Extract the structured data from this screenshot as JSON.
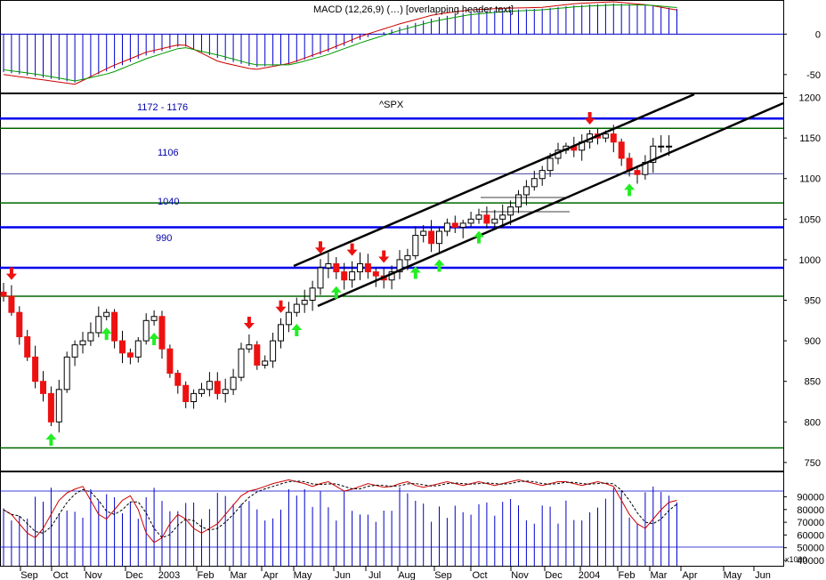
{
  "colors": {
    "up_candle": "#ffffff",
    "down_candle": "#ee1111",
    "candle_edge": "#000000",
    "support_blue": "#0000ee",
    "support_green": "#006600",
    "channel": "#000000",
    "arrow_up": "#22ee22",
    "arrow_down": "#ee1111",
    "macd_line_red": "#cc0000",
    "macd_line_green": "#009900",
    "histogram": "#0000cc",
    "stoch_k": "#cc0000",
    "stoch_d": "#000000",
    "volume": "#0000cc"
  },
  "chart_data": [
    {
      "panel": "macd",
      "type": "line",
      "title": "MACD (12,26,9) (…) [overlapping header text]",
      "y_ticks": [
        0,
        -50
      ],
      "ylim": [
        -70,
        40
      ],
      "x": [
        "Sep",
        "Oct",
        "Nov",
        "Dec",
        "2003",
        "Feb",
        "Mar",
        "Apr",
        "May",
        "Jun",
        "Jul",
        "Aug",
        "Sep",
        "Oct",
        "Nov",
        "Dec",
        "2004",
        "Feb",
        "Mar",
        "Apr"
      ],
      "series": [
        {
          "values": [
            -50,
            -56,
            -62,
            -40,
            -22,
            -12,
            -34,
            -44,
            -36,
            -20,
            -2,
            12,
            24,
            30,
            32,
            33,
            38,
            40,
            36,
            28
          ]
        },
        {
          "values": [
            -44,
            -50,
            -58,
            -48,
            -30,
            -16,
            -26,
            -38,
            -38,
            -26,
            -10,
            4,
            16,
            24,
            28,
            30,
            34,
            36,
            36,
            32
          ]
        }
      ],
      "histogram": [
        -6,
        -6,
        -4,
        8,
        8,
        4,
        -8,
        -6,
        2,
        6,
        8,
        8,
        8,
        6,
        4,
        3,
        4,
        4,
        0,
        -4
      ]
    },
    {
      "panel": "price",
      "type": "candlestick",
      "title": "^SPX",
      "y_ticks": [
        750,
        800,
        850,
        900,
        950,
        1000,
        1050,
        1100,
        1150,
        1200
      ],
      "ylim": [
        740,
        1205
      ],
      "weeks": 87,
      "closes_by_month": [
        {
          "month": "Sep",
          "close": 815
        },
        {
          "month": "Oct",
          "close": 885
        },
        {
          "month": "Nov",
          "close": 936
        },
        {
          "month": "Dec",
          "close": 880
        },
        {
          "month": "2003",
          "close": 856
        },
        {
          "month": "Feb",
          "close": 841
        },
        {
          "month": "Mar",
          "close": 848
        },
        {
          "month": "Apr",
          "close": 916
        },
        {
          "month": "May",
          "close": 964
        },
        {
          "month": "Jun",
          "close": 975
        },
        {
          "month": "Jul",
          "close": 990
        },
        {
          "month": "Aug",
          "close": 1008
        },
        {
          "month": "Sep",
          "close": 996
        },
        {
          "month": "Oct",
          "close": 1050
        },
        {
          "month": "Nov",
          "close": 1058
        },
        {
          "month": "Dec",
          "close": 1112
        },
        {
          "month": "2004",
          "close": 1131
        },
        {
          "month": "Feb",
          "close": 1145
        },
        {
          "month": "Mar",
          "close": 1126
        },
        {
          "month": "Apr",
          "close": 1135
        }
      ],
      "horizontal_levels": [
        {
          "value": 1174,
          "color": "blue",
          "label": "1172 - 1176"
        },
        {
          "value": 1162,
          "color": "green",
          "label": ""
        },
        {
          "value": 1106,
          "color": "thin",
          "label": "1106"
        },
        {
          "value": 1070,
          "color": "green",
          "label": ""
        },
        {
          "value": 1040,
          "color": "blue",
          "label": "1040"
        },
        {
          "value": 990,
          "color": "blue",
          "label": "990"
        },
        {
          "value": 955,
          "color": "green",
          "label": ""
        },
        {
          "value": 768,
          "color": "green",
          "label": ""
        }
      ],
      "labels": {
        "l1172": "1172 - 1176",
        "l1106": "1106",
        "l1040": "1040",
        "l990": "990"
      },
      "down_arrows_week": [
        1,
        31,
        35,
        40,
        44,
        48,
        74
      ],
      "up_arrows_week": [
        6,
        13,
        19,
        37,
        42,
        52,
        55,
        60,
        79
      ]
    },
    {
      "panel": "stochastic_volume",
      "type": "line",
      "y_ticks": [
        400000,
        500000,
        600000,
        700000,
        800000,
        900000
      ],
      "y_labels": [
        "40000",
        "50000",
        "60000",
        "70000",
        "80000",
        "90000"
      ],
      "unit_label": "x1000",
      "ylim": [
        0,
        100
      ]
    }
  ],
  "x_axis": {
    "labels": [
      "Sep",
      "Oct",
      "Nov",
      "Dec",
      "2003",
      "Feb",
      "Mar",
      "Apr",
      "May",
      "Jun",
      "Jul",
      "Aug",
      "Sep",
      "Oct",
      "Nov",
      "Dec",
      "2004",
      "Feb",
      "Mar",
      "Apr",
      "May",
      "Jun"
    ]
  }
}
